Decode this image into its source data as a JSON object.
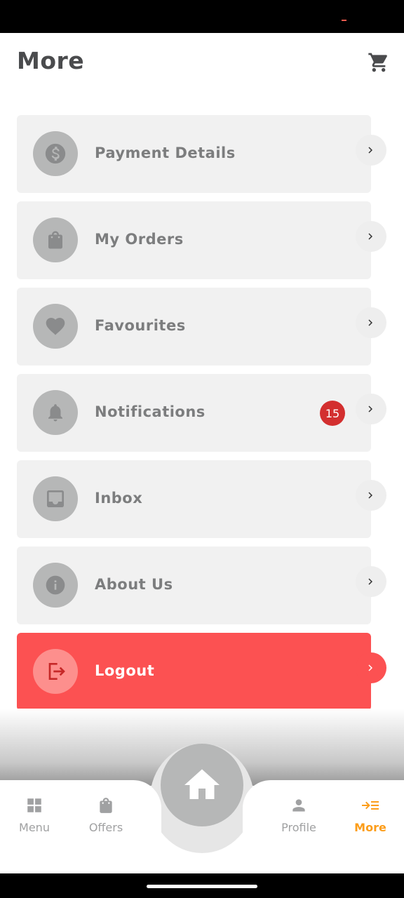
{
  "header": {
    "title": "More",
    "cart_icon": "cart-icon"
  },
  "menu": {
    "items": [
      {
        "label": "Payment Details",
        "icon": "dollar-icon"
      },
      {
        "label": "My Orders",
        "icon": "shopping-bag-icon"
      },
      {
        "label": "Favourites",
        "icon": "heart-icon"
      },
      {
        "label": "Notifications",
        "icon": "bell-icon",
        "badge": "15"
      },
      {
        "label": "Inbox",
        "icon": "inbox-icon"
      },
      {
        "label": "About Us",
        "icon": "info-icon"
      },
      {
        "label": "Logout",
        "icon": "logout-icon"
      }
    ]
  },
  "bottom_nav": {
    "items": [
      {
        "label": "Menu",
        "icon": "grid-icon",
        "active": false
      },
      {
        "label": "Offers",
        "icon": "shopping-bag-icon",
        "active": false
      },
      {
        "label": "Profile",
        "icon": "person-icon",
        "active": false
      },
      {
        "label": "More",
        "icon": "more-menu-icon",
        "active": true
      }
    ],
    "home_icon": "home-icon"
  },
  "colors": {
    "accent": "#fc9d1a",
    "logout": "#fc5152",
    "badge": "#d32f2f",
    "text_primary": "#4a4b4d",
    "text_secondary": "#7c7d7e"
  }
}
